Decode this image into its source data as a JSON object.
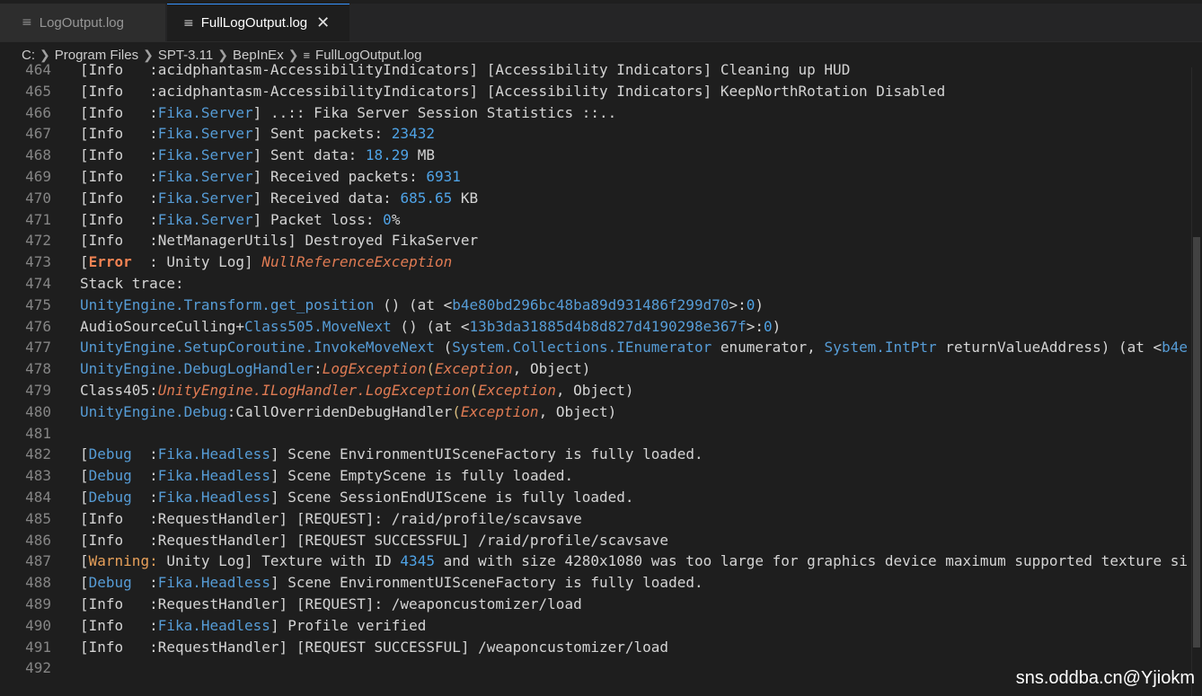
{
  "tabs": [
    {
      "label": "LogOutput.log",
      "icon": "file-lines-icon",
      "active": false
    },
    {
      "label": "FullLogOutput.log",
      "icon": "file-lines-icon",
      "active": true,
      "close_glyph": "✕"
    }
  ],
  "breadcrumb": {
    "items": [
      "C:",
      "Program Files",
      "SPT-3.11",
      "BepInEx"
    ],
    "file": "FullLogOutput.log"
  },
  "lines": [
    {
      "n": "464",
      "segs": [
        [
          "[Info   :acidphantasm-AccessibilityIndicators] [Accessibility Indicators] Cleaning up HUD",
          ""
        ]
      ]
    },
    {
      "n": "465",
      "segs": [
        [
          "[Info   :acidphantasm-AccessibilityIndicators] [Accessibility Indicators] KeepNorthRotation Disabled",
          ""
        ]
      ]
    },
    {
      "n": "466",
      "segs": [
        [
          "[Info   :",
          ""
        ],
        [
          "Fika.Server",
          "blue"
        ],
        [
          "] ..:: Fika Server Session Statistics ::..",
          ""
        ]
      ]
    },
    {
      "n": "467",
      "segs": [
        [
          "[Info   :",
          ""
        ],
        [
          "Fika.Server",
          "blue"
        ],
        [
          "] Sent packets: ",
          ""
        ],
        [
          "23432",
          "num"
        ]
      ]
    },
    {
      "n": "468",
      "segs": [
        [
          "[Info   :",
          ""
        ],
        [
          "Fika.Server",
          "blue"
        ],
        [
          "] Sent data: ",
          ""
        ],
        [
          "18.29",
          "num"
        ],
        [
          " MB",
          ""
        ]
      ]
    },
    {
      "n": "469",
      "segs": [
        [
          "[Info   :",
          ""
        ],
        [
          "Fika.Server",
          "blue"
        ],
        [
          "] Received packets: ",
          ""
        ],
        [
          "6931",
          "num"
        ]
      ]
    },
    {
      "n": "470",
      "segs": [
        [
          "[Info   :",
          ""
        ],
        [
          "Fika.Server",
          "blue"
        ],
        [
          "] Received data: ",
          ""
        ],
        [
          "685.65",
          "num"
        ],
        [
          " KB",
          ""
        ]
      ]
    },
    {
      "n": "471",
      "segs": [
        [
          "[Info   :",
          ""
        ],
        [
          "Fika.Server",
          "blue"
        ],
        [
          "] Packet loss: ",
          ""
        ],
        [
          "0",
          "num"
        ],
        [
          "%",
          ""
        ]
      ]
    },
    {
      "n": "472",
      "segs": [
        [
          "[Info   :NetManagerUtils] Destroyed FikaServer",
          ""
        ]
      ]
    },
    {
      "n": "473",
      "segs": [
        [
          "[",
          ""
        ],
        [
          "Error",
          "error"
        ],
        [
          "  : Unity Log] ",
          ""
        ],
        [
          "NullReferenceException",
          "italic"
        ]
      ]
    },
    {
      "n": "474",
      "segs": [
        [
          "Stack trace:",
          ""
        ]
      ]
    },
    {
      "n": "475",
      "segs": [
        [
          "UnityEngine.Transform.get_position",
          "blue"
        ],
        [
          " () (at <",
          ""
        ],
        [
          "b4e80bd296bc48ba89d931486f299d70",
          "blue"
        ],
        [
          ">:",
          ""
        ],
        [
          "0",
          "num"
        ],
        [
          ")",
          ""
        ]
      ]
    },
    {
      "n": "476",
      "segs": [
        [
          "AudioSourceCulling+",
          ""
        ],
        [
          "Class505.MoveNext",
          "blue"
        ],
        [
          " () (at <",
          ""
        ],
        [
          "13b3da31885d4b8d827d4190298e367f",
          "blue"
        ],
        [
          ">:",
          ""
        ],
        [
          "0",
          "num"
        ],
        [
          ")",
          ""
        ]
      ]
    },
    {
      "n": "477",
      "segs": [
        [
          "UnityEngine.SetupCoroutine.InvokeMoveNext",
          "blue"
        ],
        [
          " (",
          ""
        ],
        [
          "System.Collections.IEnumerator",
          "blue"
        ],
        [
          " enumerator, ",
          ""
        ],
        [
          "System.IntPtr",
          "blue"
        ],
        [
          " returnValueAddress) (at <",
          ""
        ],
        [
          "b4e",
          "blue"
        ]
      ]
    },
    {
      "n": "478",
      "segs": [
        [
          "UnityEngine.DebugLogHandler",
          "blue"
        ],
        [
          ":",
          ""
        ],
        [
          "LogException",
          "italic"
        ],
        [
          "(",
          "yellow"
        ],
        [
          "Exception",
          "italic"
        ],
        [
          ", Object)",
          ""
        ]
      ]
    },
    {
      "n": "479",
      "segs": [
        [
          "Class405:",
          ""
        ],
        [
          "UnityEngine.ILogHandler.LogException",
          "italic"
        ],
        [
          "(",
          "yellow"
        ],
        [
          "Exception",
          "italic"
        ],
        [
          ", Object)",
          ""
        ]
      ]
    },
    {
      "n": "480",
      "segs": [
        [
          "UnityEngine.Debug",
          "blue"
        ],
        [
          ":CallOverridenDebugHandler",
          ""
        ],
        [
          "(",
          "yellow"
        ],
        [
          "Exception",
          "italic"
        ],
        [
          ", Object)",
          ""
        ]
      ]
    },
    {
      "n": "481",
      "segs": []
    },
    {
      "n": "482",
      "segs": [
        [
          "[",
          ""
        ],
        [
          "Debug",
          "blue"
        ],
        [
          "  :",
          ""
        ],
        [
          "Fika.Headless",
          "blue"
        ],
        [
          "] Scene EnvironmentUISceneFactory is fully loaded.",
          ""
        ]
      ]
    },
    {
      "n": "483",
      "segs": [
        [
          "[",
          ""
        ],
        [
          "Debug",
          "blue"
        ],
        [
          "  :",
          ""
        ],
        [
          "Fika.Headless",
          "blue"
        ],
        [
          "] Scene EmptyScene is fully loaded.",
          ""
        ]
      ]
    },
    {
      "n": "484",
      "segs": [
        [
          "[",
          ""
        ],
        [
          "Debug",
          "blue"
        ],
        [
          "  :",
          ""
        ],
        [
          "Fika.Headless",
          "blue"
        ],
        [
          "] Scene SessionEndUIScene is fully loaded.",
          ""
        ]
      ]
    },
    {
      "n": "485",
      "segs": [
        [
          "[Info   :RequestHandler] [REQUEST]: /raid/profile/scavsave",
          ""
        ]
      ]
    },
    {
      "n": "486",
      "segs": [
        [
          "[Info   :RequestHandler] [REQUEST SUCCESSFUL] /raid/profile/scavsave",
          ""
        ]
      ]
    },
    {
      "n": "487",
      "segs": [
        [
          "[",
          ""
        ],
        [
          "Warning:",
          "warn"
        ],
        [
          " Unity Log] Texture with ID ",
          ""
        ],
        [
          "4345",
          "num"
        ],
        [
          " and with size 4280x1080 was too large for graphics device maximum supported texture si",
          ""
        ]
      ]
    },
    {
      "n": "488",
      "segs": [
        [
          "[",
          ""
        ],
        [
          "Debug",
          "blue"
        ],
        [
          "  :",
          ""
        ],
        [
          "Fika.Headless",
          "blue"
        ],
        [
          "] Scene EnvironmentUISceneFactory is fully loaded.",
          ""
        ]
      ]
    },
    {
      "n": "489",
      "segs": [
        [
          "[Info   :RequestHandler] [REQUEST]: /weaponcustomizer/load",
          ""
        ]
      ]
    },
    {
      "n": "490",
      "segs": [
        [
          "[Info   :",
          ""
        ],
        [
          "Fika.Headless",
          "blue"
        ],
        [
          "] Profile verified",
          ""
        ]
      ]
    },
    {
      "n": "491",
      "segs": [
        [
          "[Info   :RequestHandler] [REQUEST SUCCESSFUL] /weaponcustomizer/load",
          ""
        ]
      ]
    },
    {
      "n": "492",
      "segs": []
    }
  ],
  "watermark": "sns.oddba.cn@Yjiokm",
  "colors": {
    "accent": "#3794ff",
    "keyword_blue": "#569cd6",
    "number": "#4fa3e6",
    "error": "#f38353",
    "warning": "#e7a05a",
    "exception": "#e07b53"
  }
}
